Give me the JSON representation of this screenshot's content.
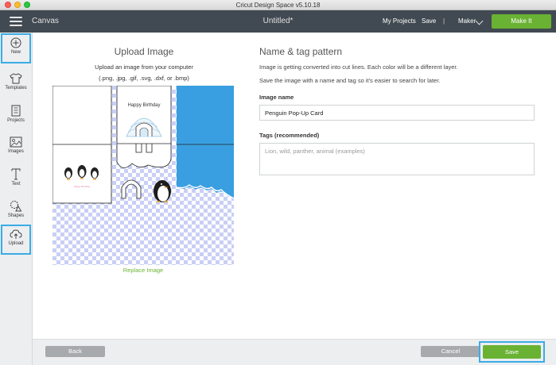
{
  "window": {
    "title": "Cricut Design Space  v5.10.18"
  },
  "header": {
    "app_name": "Canvas",
    "doc_title": "Untitled*",
    "my_projects": "My Projects",
    "save": "Save",
    "separator": "|",
    "machine": "Maker",
    "make_it": "Make It"
  },
  "sidebar": {
    "items": [
      {
        "label": "New",
        "icon": "plus-circle-icon",
        "highlighted": true
      },
      {
        "label": "Templates",
        "icon": "tshirt-icon"
      },
      {
        "label": "Projects",
        "icon": "projects-icon"
      },
      {
        "label": "Images",
        "icon": "image-icon"
      },
      {
        "label": "Text",
        "icon": "text-t-icon"
      },
      {
        "label": "Shapes",
        "icon": "shapes-icon"
      },
      {
        "label": "Upload",
        "icon": "cloud-upload-icon",
        "highlighted": true
      }
    ]
  },
  "upload": {
    "title": "Upload Image",
    "subtitle": "Upload an image from your computer",
    "formats": "(.png, .jpg, .gif, .svg, .dxf, or .bmp)",
    "preview": {
      "card_text_1": "Happy Birthday",
      "card_text_2": "Happy Birthday"
    },
    "replace_link": "Replace Image"
  },
  "form": {
    "title": "Name & tag pattern",
    "desc1": "Image is getting converted into cut lines. Each color will be a different layer.",
    "desc2": "Save the image with a name and tag so it's easier to search for later.",
    "name_label": "Image name",
    "name_value": "Penguin Pop-Up Card",
    "tags_label": "Tags (recommended)",
    "tags_placeholder": "Lion, wild, panther, animal (examples)"
  },
  "footer": {
    "back": "Back",
    "cancel": "Cancel",
    "save": "Save"
  },
  "colors": {
    "header_bg": "#414a52",
    "accent_green": "#6ab233",
    "highlight_blue": "#3aace6",
    "preview_blue": "#3a9fe0"
  }
}
